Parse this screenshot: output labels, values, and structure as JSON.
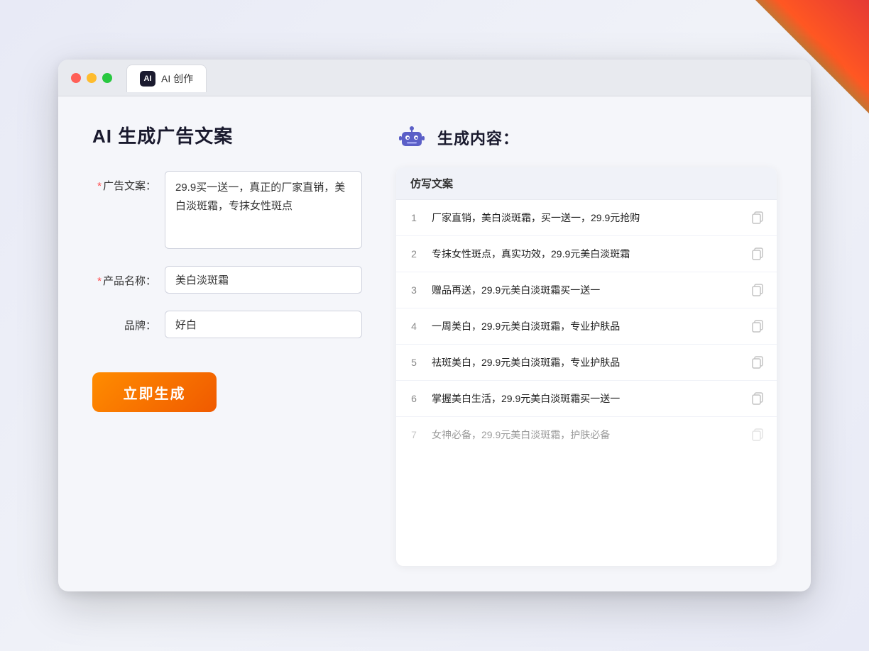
{
  "browser": {
    "tab_label": "AI 创作",
    "tab_icon": "AI"
  },
  "page": {
    "title": "AI 生成广告文案",
    "result_header": "生成内容："
  },
  "form": {
    "ad_copy_label": "广告文案：",
    "ad_copy_required": "*",
    "ad_copy_value": "29.9买一送一，真正的厂家直销，美白淡斑霜，专抹女性斑点",
    "product_name_label": "产品名称：",
    "product_name_required": "*",
    "product_name_value": "美白淡斑霜",
    "brand_label": "品牌：",
    "brand_value": "好白",
    "generate_button": "立即生成"
  },
  "results": {
    "table_header": "仿写文案",
    "items": [
      {
        "id": 1,
        "text": "厂家直销，美白淡斑霜，买一送一，29.9元抢购",
        "dimmed": false
      },
      {
        "id": 2,
        "text": "专抹女性斑点，真实功效，29.9元美白淡斑霜",
        "dimmed": false
      },
      {
        "id": 3,
        "text": "赠品再送，29.9元美白淡斑霜买一送一",
        "dimmed": false
      },
      {
        "id": 4,
        "text": "一周美白，29.9元美白淡斑霜，专业护肤品",
        "dimmed": false
      },
      {
        "id": 5,
        "text": "祛斑美白，29.9元美白淡斑霜，专业护肤品",
        "dimmed": false
      },
      {
        "id": 6,
        "text": "掌握美白生活，29.9元美白淡斑霜买一送一",
        "dimmed": false
      },
      {
        "id": 7,
        "text": "女神必备，29.9元美白淡斑霜，护肤必备",
        "dimmed": true
      }
    ]
  }
}
